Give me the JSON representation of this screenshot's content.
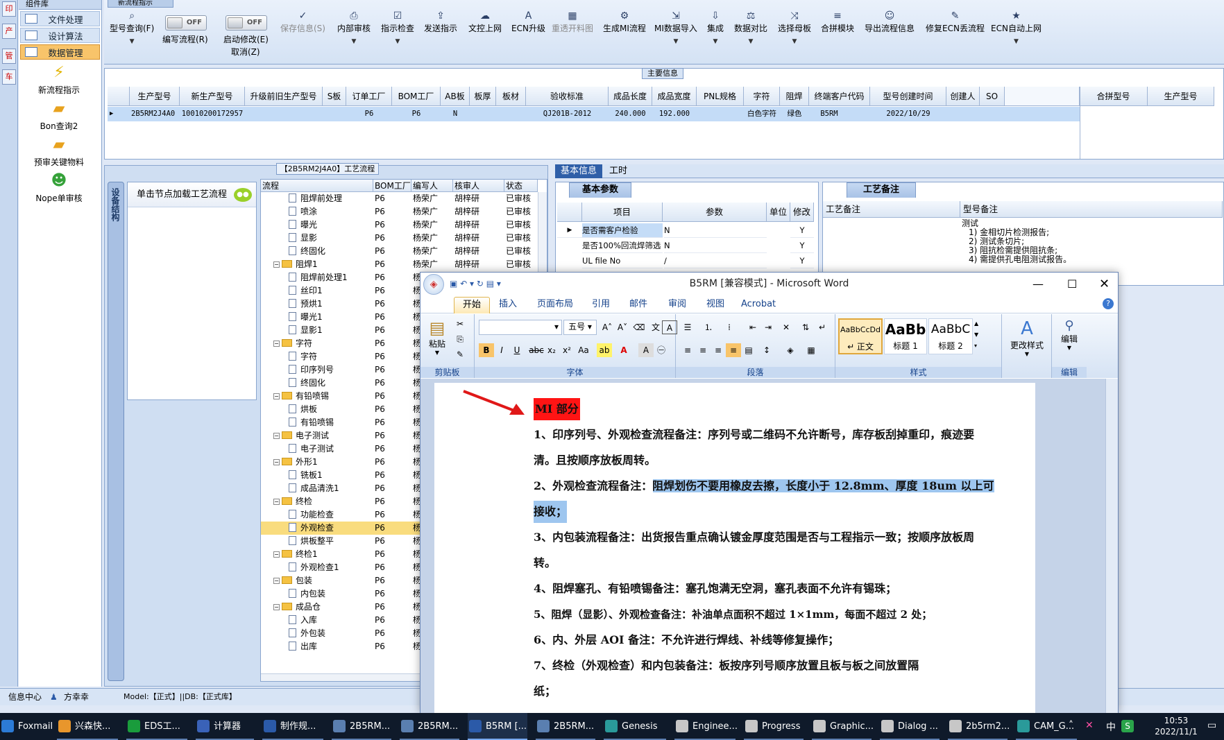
{
  "left_strip": {
    "items": [
      "印",
      "产",
      "管",
      "车"
    ]
  },
  "left_nav": {
    "header": "组件库",
    "rows": [
      {
        "label": "文件处理"
      },
      {
        "label": "设计算法"
      },
      {
        "label": "数据管理"
      }
    ],
    "big": [
      {
        "label": "新流程指示",
        "icon": "lightning-icon",
        "color": "#f2c200"
      },
      {
        "label": "Bon查询2",
        "icon": "folder-icon",
        "color": "#f0b030"
      },
      {
        "label": "预审关键物料",
        "icon": "folder-icon",
        "color": "#f0b030"
      },
      {
        "label": "Nope单审核",
        "icon": "user-icon",
        "color": "#36a23a"
      }
    ]
  },
  "ribbon": {
    "tab_title": "新流程指示",
    "buttons": [
      {
        "label": "型号查询(F)",
        "icon": "search-icon",
        "glyph": "⌕"
      },
      {
        "label": "保存信息(S)",
        "icon": "check-icon",
        "glyph": "✓"
      },
      {
        "label": "内部审核",
        "icon": "printer-icon",
        "glyph": "⎙"
      },
      {
        "label": "指示检查",
        "icon": "checklist-icon",
        "glyph": "☑"
      },
      {
        "label": "发送指示",
        "icon": "upload-icon",
        "glyph": "⇪"
      },
      {
        "label": "文控上网",
        "icon": "cloud-icon",
        "glyph": "☁"
      },
      {
        "label": "ECN升级",
        "icon": "ecn-icon",
        "glyph": "A"
      },
      {
        "label": "重透开料图",
        "icon": "image-icon",
        "glyph": "▦"
      },
      {
        "label": "生成MI流程",
        "icon": "flow-icon",
        "glyph": "⚙"
      },
      {
        "label": "MI数据导入",
        "icon": "import-icon",
        "glyph": "⇲"
      },
      {
        "label": "集成",
        "icon": "download-icon",
        "glyph": "⇩"
      },
      {
        "label": "数据对比",
        "icon": "compare-icon",
        "glyph": "⚖"
      },
      {
        "label": "选择母板",
        "icon": "shuffle-icon",
        "glyph": "⤨"
      },
      {
        "label": "合拼模块",
        "icon": "list-icon",
        "glyph": "≡"
      },
      {
        "label": "导出流程信息",
        "icon": "smile-icon",
        "glyph": "☺"
      },
      {
        "label": "修复ECN丢流程",
        "icon": "wrench-icon",
        "glyph": "✎"
      },
      {
        "label": "ECN自动上网",
        "icon": "star-icon",
        "glyph": "★"
      }
    ],
    "toggle_write": {
      "label": "编写流程(R)",
      "state": "OFF"
    },
    "toggle_modify": {
      "label": "启动修改(E)",
      "label2": "取消(Z)",
      "state": "OFF"
    }
  },
  "main_info": {
    "title": "主要信息",
    "columns": [
      "生产型号",
      "新生产型号",
      "升级前旧生产型号",
      "S板",
      "订单工厂",
      "BOM工厂",
      "AB板",
      "板厚",
      "板材",
      "验收标准",
      "成品长度",
      "成品宽度",
      "PNL规格",
      "字符",
      "阻焊",
      "终端客户代码",
      "型号创建时间",
      "创建人",
      "SO"
    ],
    "row": [
      "2B5RM2J4A0",
      "10010200172957",
      "",
      "",
      "P6",
      "P6",
      "N",
      "",
      "",
      "QJ201B-2012",
      "240.000",
      "192.000",
      "",
      "白色字符",
      "绿色",
      "B5RM",
      "2022/10/29",
      "",
      ""
    ],
    "right_columns": [
      "合拼型号",
      "生产型号"
    ]
  },
  "process": {
    "title": "【2B5RM2J4A0】工艺流程",
    "side_tab": "设备结构",
    "node_hint": "单击节点加载工艺流程",
    "columns": [
      "流程",
      "BOM工厂",
      "编写人",
      "核审人",
      "状态"
    ],
    "rows": [
      {
        "name": "阻焊前处理",
        "level": 2,
        "type": "leaf",
        "factory": "P6",
        "writer": "杨荣广",
        "reviewer": "胡梓研",
        "status": "已审核"
      },
      {
        "name": "喷涂",
        "level": 2,
        "type": "leaf",
        "factory": "P6",
        "writer": "杨荣广",
        "reviewer": "胡梓研",
        "status": "已审核"
      },
      {
        "name": "曝光",
        "level": 2,
        "type": "leaf",
        "factory": "P6",
        "writer": "杨荣广",
        "reviewer": "胡梓研",
        "status": "已审核"
      },
      {
        "name": "显影",
        "level": 2,
        "type": "leaf",
        "factory": "P6",
        "writer": "杨荣广",
        "reviewer": "胡梓研",
        "status": "已审核"
      },
      {
        "name": "终固化",
        "level": 2,
        "type": "leaf",
        "factory": "P6",
        "writer": "杨荣广",
        "reviewer": "胡梓研",
        "status": "已审核"
      },
      {
        "name": "阻焊1",
        "level": 1,
        "type": "folder",
        "factory": "P6",
        "writer": "杨荣广",
        "reviewer": "胡梓研",
        "status": "已审核"
      },
      {
        "name": "阻焊前处理1",
        "level": 2,
        "type": "leaf",
        "factory": "P6",
        "writer": "杨荣广",
        "reviewer": "胡梓研",
        "status": "已审核"
      },
      {
        "name": "丝印1",
        "level": 2,
        "type": "leaf",
        "factory": "P6",
        "writer": "杨",
        "reviewer": "",
        "status": ""
      },
      {
        "name": "预烘1",
        "level": 2,
        "type": "leaf",
        "factory": "P6",
        "writer": "杨",
        "reviewer": "",
        "status": ""
      },
      {
        "name": "曝光1",
        "level": 2,
        "type": "leaf",
        "factory": "P6",
        "writer": "杨",
        "reviewer": "",
        "status": ""
      },
      {
        "name": "显影1",
        "level": 2,
        "type": "leaf",
        "factory": "P6",
        "writer": "杨",
        "reviewer": "",
        "status": ""
      },
      {
        "name": "字符",
        "level": 1,
        "type": "folder",
        "factory": "P6",
        "writer": "杨",
        "reviewer": "",
        "status": ""
      },
      {
        "name": "字符",
        "level": 2,
        "type": "leaf",
        "factory": "P6",
        "writer": "杨",
        "reviewer": "",
        "status": ""
      },
      {
        "name": "印序列号",
        "level": 2,
        "type": "leaf",
        "factory": "P6",
        "writer": "杨",
        "reviewer": "",
        "status": ""
      },
      {
        "name": "终固化",
        "level": 2,
        "type": "leaf",
        "factory": "P6",
        "writer": "杨",
        "reviewer": "",
        "status": ""
      },
      {
        "name": "有铅喷锡",
        "level": 1,
        "type": "folder",
        "factory": "P6",
        "writer": "杨",
        "reviewer": "",
        "status": ""
      },
      {
        "name": "烘板",
        "level": 2,
        "type": "leaf",
        "factory": "P6",
        "writer": "杨",
        "reviewer": "",
        "status": ""
      },
      {
        "name": "有铅喷锡",
        "level": 2,
        "type": "leaf",
        "factory": "P6",
        "writer": "杨",
        "reviewer": "",
        "status": ""
      },
      {
        "name": "电子测试",
        "level": 1,
        "type": "folder",
        "factory": "P6",
        "writer": "杨",
        "reviewer": "",
        "status": ""
      },
      {
        "name": "电子测试",
        "level": 2,
        "type": "leaf",
        "factory": "P6",
        "writer": "杨",
        "reviewer": "",
        "status": ""
      },
      {
        "name": "外形1",
        "level": 1,
        "type": "folder",
        "factory": "P6",
        "writer": "杨",
        "reviewer": "",
        "status": ""
      },
      {
        "name": "铣板1",
        "level": 2,
        "type": "leaf",
        "factory": "P6",
        "writer": "杨",
        "reviewer": "",
        "status": ""
      },
      {
        "name": "成品清洗1",
        "level": 2,
        "type": "leaf",
        "factory": "P6",
        "writer": "杨",
        "reviewer": "",
        "status": ""
      },
      {
        "name": "终检",
        "level": 1,
        "type": "folder",
        "factory": "P6",
        "writer": "杨",
        "reviewer": "",
        "status": ""
      },
      {
        "name": "功能检查",
        "level": 2,
        "type": "leaf",
        "factory": "P6",
        "writer": "杨",
        "reviewer": "",
        "status": ""
      },
      {
        "name": "外观检查",
        "level": 2,
        "type": "leaf",
        "factory": "P6",
        "writer": "杨",
        "reviewer": "",
        "status": "",
        "selected": true
      },
      {
        "name": "烘板整平",
        "level": 2,
        "type": "leaf",
        "factory": "P6",
        "writer": "杨",
        "reviewer": "",
        "status": ""
      },
      {
        "name": "终检1",
        "level": 1,
        "type": "folder",
        "factory": "P6",
        "writer": "杨",
        "reviewer": "",
        "status": ""
      },
      {
        "name": "外观检查1",
        "level": 2,
        "type": "leaf",
        "factory": "P6",
        "writer": "杨",
        "reviewer": "",
        "status": ""
      },
      {
        "name": "包装",
        "level": 1,
        "type": "folder",
        "factory": "P6",
        "writer": "杨",
        "reviewer": "",
        "status": ""
      },
      {
        "name": "内包装",
        "level": 2,
        "type": "leaf",
        "factory": "P6",
        "writer": "杨",
        "reviewer": "",
        "status": ""
      },
      {
        "name": "成品仓",
        "level": 1,
        "type": "folder",
        "factory": "P6",
        "writer": "杨",
        "reviewer": "",
        "status": ""
      },
      {
        "name": "入库",
        "level": 2,
        "type": "leaf",
        "factory": "P6",
        "writer": "杨",
        "reviewer": "",
        "status": ""
      },
      {
        "name": "外包装",
        "level": 2,
        "type": "leaf",
        "factory": "P6",
        "writer": "杨",
        "reviewer": "",
        "status": ""
      },
      {
        "name": "出库",
        "level": 2,
        "type": "leaf",
        "factory": "P6",
        "writer": "杨",
        "reviewer": "",
        "status": ""
      }
    ]
  },
  "right_tabs": {
    "basic": "基本信息",
    "hours": "工时"
  },
  "basic_params": {
    "tab": "基本参数",
    "columns": [
      "项目",
      "参数",
      "单位",
      "修改"
    ],
    "rows": [
      {
        "item": "是否需客户检验",
        "value": "N",
        "unit": "",
        "mod": "Y"
      },
      {
        "item": "是否100%回流焊筛选",
        "value": "N",
        "unit": "",
        "mod": "Y"
      },
      {
        "item": "UL file No",
        "value": "/",
        "unit": "",
        "mod": "Y"
      }
    ]
  },
  "remarks": {
    "tab": "工艺备注",
    "columns": [
      "工艺备注",
      "型号备注"
    ],
    "model_note": [
      "测试",
      "1) 金相切片检测报告;",
      "2) 测试条切片;",
      "3) 阻抗检需提供阻抗条;",
      "4) 需提供孔电阻测试报告。"
    ]
  },
  "word": {
    "title": "B5RM [兼容模式] - Microsoft Word",
    "tabs": [
      "开始",
      "插入",
      "页面布局",
      "引用",
      "邮件",
      "审阅",
      "视图",
      "Acrobat"
    ],
    "font_size": "五号",
    "groups": [
      "剪贴板",
      "字体",
      "段落",
      "样式",
      "编辑"
    ],
    "paste": "粘贴",
    "change_style": "更改样式",
    "edit": "编辑",
    "styles": [
      {
        "preview": "AaBbCcDd",
        "label": "↵ 正文"
      },
      {
        "preview": "AaBb",
        "label": "标题 1"
      },
      {
        "preview": "AaBbC",
        "label": "标题 2"
      }
    ],
    "doc": {
      "heading": "MI 部分",
      "lines": [
        "1、印序列号、外观检查流程备注：序列号或二维码不允许断号，库存板刮掉重印，痕迹要",
        "清。且按顺序放板周转。",
        "2、外观检查流程备注：阻焊划伤不要用橡皮去擦，长度小于 12.8mm、厚度 18um 以上可",
        "接收；",
        "3、内包装流程备注：出货报告重点确认镀金厚度范围是否与工程指示一致；按顺序放板周",
        "转。",
        "4、阻焊塞孔、有铅喷锡备注：塞孔饱满无空洞，塞孔表面不允许有锡珠；",
        "5、阻焊（显影）、外观检查备注：补油单点面积不超过 1×1mm，每面不超过 2 处；",
        "6、内、外层 AOI 备注：不允许进行焊线、补线等修复操作；",
        "7、终检（外观检查）和内包装备注：板按序列号顺序放置且板与板之间放置隔",
        "纸；"
      ]
    }
  },
  "statusbar": {
    "info": "信息中心",
    "user": "方幸幸",
    "model": "Model:【正式】||DB:【正式库】"
  },
  "taskbar": {
    "items": [
      {
        "label": "Foxmail",
        "color": "#2c7bd6"
      },
      {
        "label": "兴森快...",
        "color": "#e8962c"
      },
      {
        "label": "EDS工...",
        "color": "#1a9c3c"
      },
      {
        "label": "计算器",
        "color": "#3a62b8"
      },
      {
        "label": "制作规...",
        "color": "#2b5aa8"
      },
      {
        "label": "2B5RM...",
        "color": "#5a7fb0"
      },
      {
        "label": "2B5RM...",
        "color": "#5a7fb0"
      },
      {
        "label": "B5RM [...",
        "color": "#2b5aa8"
      },
      {
        "label": "2B5RM...",
        "color": "#5a7fb0"
      },
      {
        "label": "Genesis",
        "color": "#2a9a9a"
      },
      {
        "label": "Enginee...",
        "color": "#c7c7c7"
      },
      {
        "label": "Progress",
        "color": "#c7c7c7"
      },
      {
        "label": "Graphic...",
        "color": "#c7c7c7"
      },
      {
        "label": "Dialog ...",
        "color": "#c7c7c7"
      },
      {
        "label": "2b5rm2...",
        "color": "#c7c7c7"
      },
      {
        "label": "CAM_G...",
        "color": "#2a9a9a"
      }
    ],
    "ime": "中",
    "time": "10:53",
    "date": "2022/11/1"
  }
}
